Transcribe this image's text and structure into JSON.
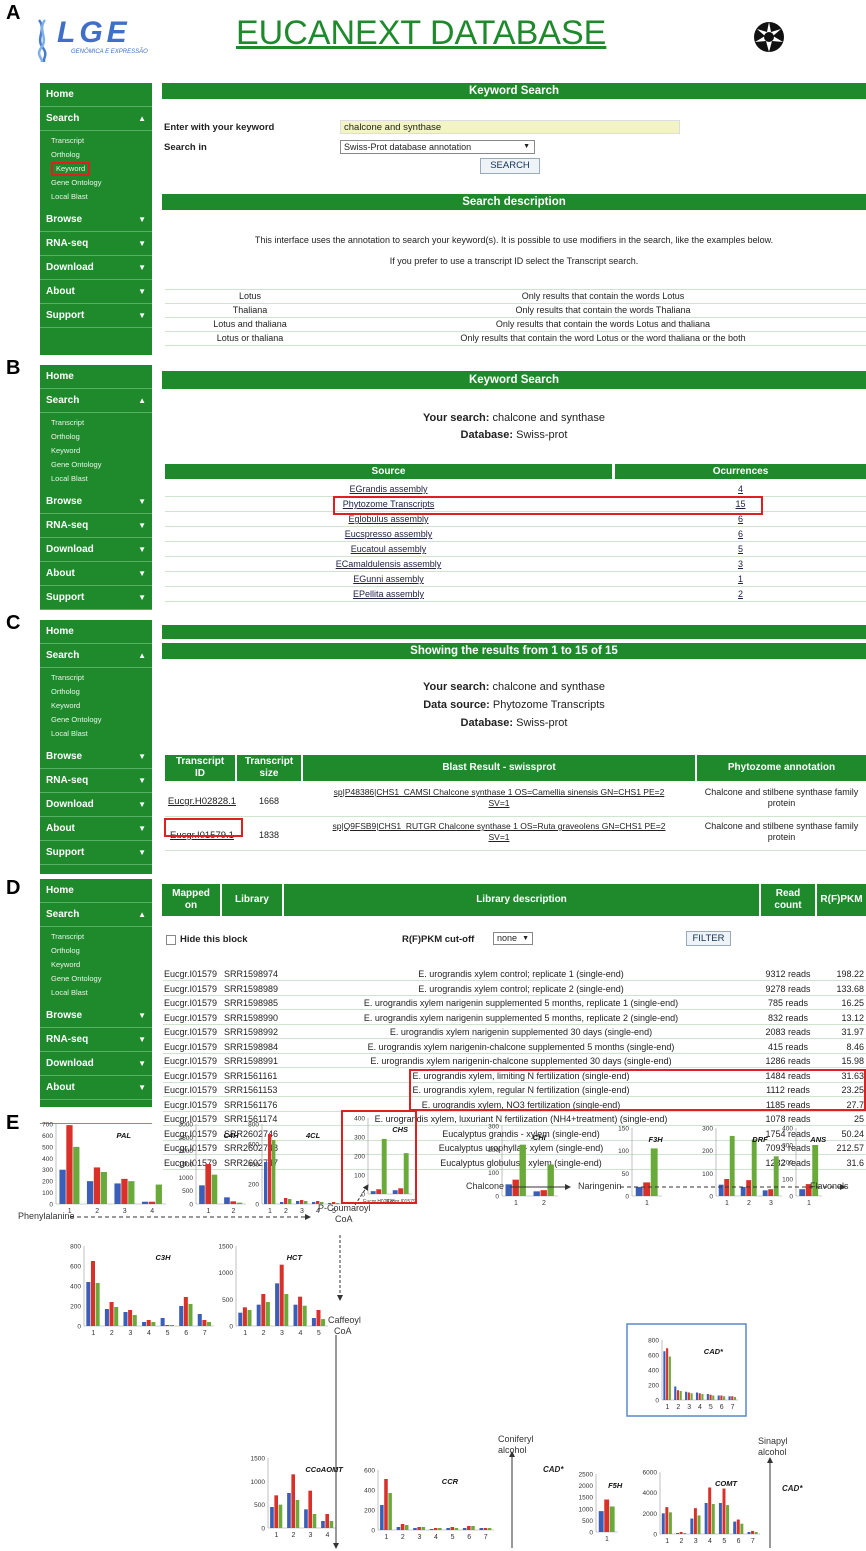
{
  "panel_labels": {
    "a": "A",
    "b": "B",
    "c": "C",
    "d": "D",
    "e": "E"
  },
  "header": {
    "logo_text": "LGE",
    "logo_sub": "GENÔMICA E EXPRESSÃO",
    "title": "EUCANEXT DATABASE"
  },
  "sidebar": {
    "home": "Home",
    "search": "Search",
    "browse": "Browse",
    "rnaseq": "RNA-seq",
    "download": "Download",
    "about": "About",
    "support": "Support",
    "sub": [
      "Transcript",
      "Ortholog",
      "Keyword",
      "Gene Ontology",
      "Local Blast"
    ]
  },
  "panelA": {
    "bar_title": "Keyword Search",
    "keyword_label": "Enter with your keyword",
    "keyword_value": "chalcone and synthase",
    "searchin_label": "Search in",
    "searchin_value": "Swiss-Prot database annotation",
    "search_button": "SEARCH",
    "desc_title": "Search description",
    "desc1": "This interface uses the annotation to search your keyword(s). It is possible to use modifiers in the search, like the examples below.",
    "desc2": "If you prefer to use a transcript ID select the Transcript search.",
    "examples": [
      {
        "k": "Lotus",
        "v": "Only results that contain the words Lotus"
      },
      {
        "k": "Thaliana",
        "v": "Only results that contain the words Thaliana"
      },
      {
        "k": "Lotus and thaliana",
        "v": "Only results that contain the words Lotus and thaliana"
      },
      {
        "k": "Lotus or thaliana",
        "v": "Only results that contain the word Lotus or the word thaliana or the both"
      }
    ]
  },
  "panelB": {
    "bar_title": "Keyword Search",
    "your_search_label": "Your search:",
    "your_search": "chalcone and synthase",
    "database_label": "Database:",
    "database": "Swiss-prot",
    "col_source": "Source",
    "col_occ": "Ocurrences",
    "rows": [
      {
        "s": "EGrandis assembly",
        "o": "4"
      },
      {
        "s": "Phytozome Transcripts",
        "o": "15"
      },
      {
        "s": "Eglobulus assembly",
        "o": "6"
      },
      {
        "s": "Eucspresso assembly",
        "o": "6"
      },
      {
        "s": "Eucatoul assembly",
        "o": "5"
      },
      {
        "s": "ECamaldulensis assembly",
        "o": "3"
      },
      {
        "s": "EGunni assembly",
        "o": "1"
      },
      {
        "s": "EPellita assembly",
        "o": "2"
      }
    ]
  },
  "panelC": {
    "bar_title": "Showing the results from 1 to 15 of 15",
    "your_search_label": "Your search:",
    "your_search": "chalcone and synthase",
    "source_label": "Data source:",
    "source": "Phytozome Transcripts",
    "database_label": "Database:",
    "database": "Swiss-prot",
    "col1a": "Transcript",
    "col1b": "ID",
    "col2a": "Transcript",
    "col2b": "size",
    "col3": "Blast Result - swissprot",
    "col4": "Phytozome annotation",
    "rows": [
      {
        "id": "Eucgr.H02828.1",
        "size": "1668",
        "blast1": "sp|P48386|CHS1_CAMSI Chalcone synthase 1 OS=Camellia sinensis GN=CHS1 PE=2",
        "blast2": "SV=1",
        "ann1": "Chalcone and stilbene synthase family",
        "ann2": "protein"
      },
      {
        "id": "Eucgr.I01579.1",
        "size": "1838",
        "blast1": "sp|Q9FSB9|CHS1_RUTGR Chalcone synthase 1 OS=Ruta graveolens GN=CHS1 PE=2",
        "blast2": "SV=1",
        "ann1": "Chalcone and stilbene synthase family",
        "ann2": "protein"
      }
    ]
  },
  "panelD": {
    "col1a": "Mapped",
    "col1b": "on",
    "col2": "Library",
    "col3": "Library description",
    "col4a": "Read",
    "col4b": "count",
    "col5": "R(F)PKM",
    "hide_label": "Hide this block",
    "cutoff_label": "R(F)PKM cut-off",
    "cutoff_value": "none",
    "filter_button": "FILTER",
    "rows": [
      {
        "m": "Eucgr.I01579",
        "l": "SRR1598974",
        "d": "E. urograndis xylem control; replicate 1 (single-end)",
        "r": "9312 reads",
        "p": "198.22"
      },
      {
        "m": "Eucgr.I01579",
        "l": "SRR1598989",
        "d": "E. urograndis xylem control; replicate 2 (single-end)",
        "r": "9278 reads",
        "p": "133.68"
      },
      {
        "m": "Eucgr.I01579",
        "l": "SRR1598985",
        "d": "E. urograndis xylem narigenin supplemented 5 months, replicate 1 (single-end)",
        "r": "785 reads",
        "p": "16.25"
      },
      {
        "m": "Eucgr.I01579",
        "l": "SRR1598990",
        "d": "E. urograndis xylem narigenin supplemented 5 months, replicate 2 (single-end)",
        "r": "832 reads",
        "p": "13.12"
      },
      {
        "m": "Eucgr.I01579",
        "l": "SRR1598992",
        "d": "E. urograndis xylem narigenin supplemented 30 days (single-end)",
        "r": "2083 reads",
        "p": "31.97"
      },
      {
        "m": "Eucgr.I01579",
        "l": "SRR1598984",
        "d": "E. urograndis xylem narigenin-chalcone supplemented 5 months (single-end)",
        "r": "415 reads",
        "p": "8.46"
      },
      {
        "m": "Eucgr.I01579",
        "l": "SRR1598991",
        "d": "E. urograndis xylem narigenin-chalcone supplemented 30 days (single-end)",
        "r": "1286 reads",
        "p": "15.98"
      },
      {
        "m": "Eucgr.I01579",
        "l": "SRR1561161",
        "d": "E. urograndis xylem, limiting N fertilization (single-end)",
        "r": "1484 reads",
        "p": "31.63"
      },
      {
        "m": "Eucgr.I01579",
        "l": "SRR1561153",
        "d": "E. urograndis xylem, regular N fertilization (single-end)",
        "r": "1112 reads",
        "p": "23.25"
      },
      {
        "m": "Eucgr.I01579",
        "l": "SRR1561176",
        "d": "E. urograndis xylem, NO3 fertilization (single-end)",
        "r": "1185 reads",
        "p": "27.7"
      },
      {
        "m": "Eucgr.I01579",
        "l": "SRR1561174",
        "d": "E. urograndis xylem, luxuriant N fertilization (NH4+treatment) (single-end)",
        "r": "1078 reads",
        "p": "25"
      },
      {
        "m": "Eucgr.I01579",
        "l": "SRR2602746",
        "d": "Eucalyptus grandis - xylem (single-end)",
        "r": "1754 reads",
        "p": "50.24"
      },
      {
        "m": "Eucgr.I01579",
        "l": "SRR2602748",
        "d": "Eucalyptus urophylla - xylem (single-end)",
        "r": "7093 reads",
        "p": "212.57"
      },
      {
        "m": "Eucgr.I01579",
        "l": "SRR2602747",
        "d": "Eucalyptus globulus - xylem (single-end)",
        "r": "1282 reads",
        "p": "31.6"
      }
    ]
  },
  "panelE": {
    "pathway": {
      "phenylalanine": "Phenylalanine",
      "pcoumaroyl": "P-Coumaroyl",
      "coa1": "CoA",
      "chalcone": "Chalcone",
      "naringenin": "Naringenin",
      "flavonols": "Flavonols",
      "caffeoyl": "Caffeoyl",
      "coa2": "CoA",
      "coniferyl": "Coniferyl",
      "alcohol1": "alcohol",
      "sinapyl": "Sinapyl",
      "alcohol2": "alcohol",
      "cad1": "CAD*",
      "cad2": "CAD*"
    },
    "colors": {
      "blue": "#3b5fb8",
      "red": "#d9302a",
      "green": "#6aaa3a"
    }
  },
  "chart_data": [
    {
      "type": "bar",
      "title": "PAL",
      "categories": [
        "1",
        "2",
        "3",
        "4"
      ],
      "ylim": [
        0,
        700
      ],
      "ticks": [
        "700",
        "600",
        "500",
        "400",
        "300",
        "200",
        "100",
        "0"
      ],
      "series": [
        {
          "values": [
            300,
            200,
            180,
            20
          ]
        },
        {
          "values": [
            690,
            320,
            220,
            20
          ]
        },
        {
          "values": [
            500,
            280,
            200,
            170
          ]
        }
      ]
    },
    {
      "type": "bar",
      "title": "C4H",
      "categories": [
        "1",
        "2"
      ],
      "ylim": [
        0,
        3000
      ],
      "ticks": [
        "3000",
        "2500",
        "2000",
        "1500",
        "1000",
        "500",
        "0"
      ],
      "series": [
        {
          "values": [
            700,
            250
          ]
        },
        {
          "values": [
            1500,
            100
          ]
        },
        {
          "values": [
            1100,
            50
          ]
        }
      ]
    },
    {
      "type": "bar",
      "title": "4CL",
      "categories": [
        "1",
        "2",
        "3",
        "4",
        "5"
      ],
      "ylim": [
        0,
        800
      ],
      "ticks": [
        "800",
        "600",
        "400",
        "200",
        "0"
      ],
      "series": [
        {
          "values": [
            420,
            20,
            30,
            20,
            10
          ]
        },
        {
          "values": [
            700,
            60,
            40,
            30,
            20
          ]
        },
        {
          "values": [
            640,
            50,
            30,
            20,
            10
          ]
        }
      ]
    },
    {
      "type": "bar",
      "title": "CHS",
      "categories": [
        "Eucgr.H02828",
        "Eucgr.I01579"
      ],
      "ylim": [
        0,
        400
      ],
      "ticks": [
        "400",
        "300",
        "200",
        "100",
        "0"
      ],
      "series": [
        {
          "values": [
            15,
            20
          ]
        },
        {
          "values": [
            25,
            30
          ]
        },
        {
          "values": [
            290,
            215
          ]
        }
      ]
    },
    {
      "type": "bar",
      "title": "CHI",
      "categories": [
        "1",
        "2"
      ],
      "ylim": [
        0,
        300
      ],
      "ticks": [
        "300",
        "200",
        "100",
        "0"
      ],
      "series": [
        {
          "values": [
            50,
            20
          ]
        },
        {
          "values": [
            70,
            25
          ]
        },
        {
          "values": [
            220,
            135
          ]
        }
      ]
    },
    {
      "type": "bar",
      "title": "F3H",
      "categories": [
        "1"
      ],
      "ylim": [
        0,
        150
      ],
      "ticks": [
        "150",
        "100",
        "50",
        "0"
      ],
      "series": [
        {
          "values": [
            20
          ]
        },
        {
          "values": [
            30
          ]
        },
        {
          "values": [
            105
          ]
        }
      ]
    },
    {
      "type": "bar",
      "title": "DRF",
      "categories": [
        "1",
        "2",
        "3"
      ],
      "ylim": [
        0,
        300
      ],
      "ticks": [
        "300",
        "200",
        "100",
        "0"
      ],
      "series": [
        {
          "values": [
            50,
            40,
            25
          ]
        },
        {
          "values": [
            75,
            70,
            30
          ]
        },
        {
          "values": [
            265,
            250,
            175
          ]
        }
      ]
    },
    {
      "type": "bar",
      "title": "ANS",
      "categories": [
        "1"
      ],
      "ylim": [
        0,
        400
      ],
      "ticks": [
        "400",
        "300",
        "200",
        "100",
        "0"
      ],
      "series": [
        {
          "values": [
            40
          ]
        },
        {
          "values": [
            70
          ]
        },
        {
          "values": [
            300
          ]
        }
      ]
    },
    {
      "type": "bar",
      "title": "C3H",
      "categories": [
        "1",
        "2",
        "3",
        "4",
        "5",
        "6",
        "7"
      ],
      "ylim": [
        0,
        800
      ],
      "ticks": [
        "800",
        "600",
        "400",
        "200",
        "0"
      ],
      "series": [
        {
          "values": [
            440,
            170,
            140,
            40,
            80,
            200,
            120
          ]
        },
        {
          "values": [
            650,
            240,
            160,
            60,
            10,
            290,
            60
          ]
        },
        {
          "values": [
            430,
            190,
            110,
            40,
            10,
            220,
            40
          ]
        }
      ]
    },
    {
      "type": "bar",
      "title": "HCT",
      "categories": [
        "1",
        "2",
        "3",
        "4",
        "5"
      ],
      "ylim": [
        0,
        1500
      ],
      "ticks": [
        "1500",
        "1000",
        "500",
        "0"
      ],
      "series": [
        {
          "values": [
            250,
            400,
            800,
            400,
            150
          ]
        },
        {
          "values": [
            350,
            600,
            1150,
            550,
            300
          ]
        },
        {
          "values": [
            300,
            450,
            600,
            380,
            130
          ]
        }
      ]
    },
    {
      "type": "bar",
      "title": "CAD*",
      "categories": [
        "1",
        "2",
        "3",
        "4",
        "5",
        "6",
        "7"
      ],
      "ylim": [
        0,
        800
      ],
      "ticks": [
        "800",
        "600",
        "400",
        "200",
        "0"
      ],
      "series": [
        {
          "values": [
            650,
            180,
            110,
            100,
            80,
            60,
            50
          ]
        },
        {
          "values": [
            690,
            130,
            100,
            90,
            70,
            60,
            50
          ]
        },
        {
          "values": [
            580,
            120,
            90,
            80,
            60,
            50,
            40
          ]
        }
      ]
    },
    {
      "type": "bar",
      "title": "CCoAOMT",
      "categories": [
        "1",
        "2",
        "3",
        "4"
      ],
      "ylim": [
        0,
        1500
      ],
      "ticks": [
        "1500",
        "1000",
        "500",
        "0"
      ],
      "series": [
        {
          "values": [
            450,
            750,
            400,
            150
          ]
        },
        {
          "values": [
            700,
            1150,
            800,
            300
          ]
        },
        {
          "values": [
            500,
            600,
            300,
            150
          ]
        }
      ]
    },
    {
      "type": "bar",
      "title": "CCR",
      "categories": [
        "1",
        "2",
        "3",
        "4",
        "5",
        "6",
        "7"
      ],
      "ylim": [
        0,
        600
      ],
      "ticks": [
        "600",
        "400",
        "200",
        "0"
      ],
      "series": [
        {
          "values": [
            250,
            30,
            20,
            10,
            20,
            20,
            20
          ]
        },
        {
          "values": [
            510,
            60,
            30,
            20,
            30,
            40,
            20
          ]
        },
        {
          "values": [
            370,
            50,
            30,
            20,
            20,
            40,
            20
          ]
        }
      ]
    },
    {
      "type": "bar",
      "title": "F5H",
      "categories": [
        "1"
      ],
      "ylim": [
        0,
        2500
      ],
      "ticks": [
        "2500",
        "2000",
        "1500",
        "1000",
        "500",
        "0"
      ],
      "series": [
        {
          "values": [
            900
          ]
        },
        {
          "values": [
            1400
          ]
        },
        {
          "values": [
            1100
          ]
        }
      ]
    },
    {
      "type": "bar",
      "title": "COMT",
      "categories": [
        "1",
        "2",
        "3",
        "4",
        "5",
        "6",
        "7"
      ],
      "ylim": [
        0,
        6000
      ],
      "ticks": [
        "6000",
        "4000",
        "2000",
        "0"
      ],
      "series": [
        {
          "values": [
            2000,
            100,
            1500,
            3000,
            3000,
            1200,
            200
          ]
        },
        {
          "values": [
            2600,
            200,
            2500,
            4500,
            4400,
            1400,
            300
          ]
        },
        {
          "values": [
            2100,
            100,
            1800,
            2900,
            2800,
            1000,
            200
          ]
        }
      ]
    }
  ]
}
